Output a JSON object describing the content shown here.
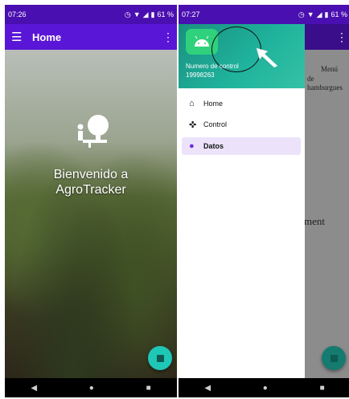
{
  "left_phone": {
    "status": {
      "time": "07:26",
      "battery": "61 %"
    },
    "appbar": {
      "title": "Home"
    },
    "welcome": {
      "line1": "Bienvenido a",
      "line2": "AgroTracker"
    }
  },
  "right_phone": {
    "status": {
      "time": "07:27",
      "battery": "61 %"
    },
    "background_text": {
      "menu": "Menú",
      "de": "de",
      "hamburguesa": "hamburgues",
      "ment": "ment"
    },
    "drawer": {
      "header_label": "Numero de control",
      "header_value": "19998263",
      "items": [
        {
          "label": "Home",
          "icon": "home-icon"
        },
        {
          "label": "Control",
          "icon": "gamepad-icon"
        },
        {
          "label": "Datos",
          "icon": "data-icon"
        }
      ],
      "active_item": "Datos"
    }
  },
  "colors": {
    "status_bar": "#4a0fb0",
    "app_bar": "#5a16d6",
    "drawer_header": "#1fb29c",
    "fab": "#1fc7b6",
    "active_item_bg": "#ece3fb"
  }
}
